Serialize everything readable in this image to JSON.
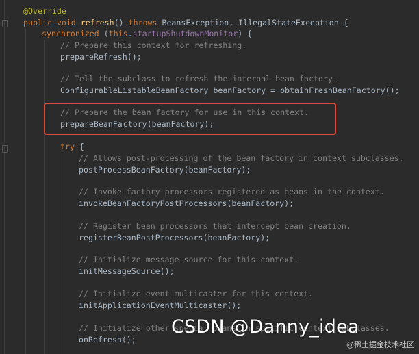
{
  "editor": {
    "lines": [
      [
        {
          "c": "ann",
          "t": "@Override"
        }
      ],
      [
        {
          "c": "kw",
          "t": "public void "
        },
        {
          "c": "fn",
          "t": "refresh"
        },
        {
          "c": "plain",
          "t": "() "
        },
        {
          "c": "kw",
          "t": "throws "
        },
        {
          "c": "plain",
          "t": "BeansException, IllegalStateException {"
        }
      ],
      [
        {
          "c": "kw",
          "t": "synchronized "
        },
        {
          "c": "plain",
          "t": "("
        },
        {
          "c": "kw",
          "t": "this"
        },
        {
          "c": "plain",
          "t": "."
        },
        {
          "c": "fld",
          "t": "startupShutdownMonitor"
        },
        {
          "c": "plain",
          "t": ") {"
        }
      ],
      [
        {
          "c": "cm",
          "t": "// Prepare this context for refreshing."
        }
      ],
      [
        {
          "c": "plain",
          "t": "prepareRefresh();"
        }
      ],
      [
        {
          "c": "cm",
          "t": "// Tell the subclass to refresh the internal bean factory."
        }
      ],
      [
        {
          "c": "plain",
          "t": "ConfigurableListableBeanFactory beanFactory = obtainFreshBeanFactory();"
        }
      ],
      [
        {
          "c": "cm",
          "t": "// Prepare the bean factory for use in this context."
        }
      ],
      [
        {
          "c": "plain",
          "t": "prepareBeanFa"
        },
        {
          "c": "caret",
          "t": ""
        },
        {
          "c": "plain",
          "t": "ctory(beanFactory);"
        }
      ],
      [
        {
          "c": "kw",
          "t": "try "
        },
        {
          "c": "plain",
          "t": "{"
        }
      ],
      [
        {
          "c": "cm",
          "t": "// Allows post-processing of the bean factory in context subclasses."
        }
      ],
      [
        {
          "c": "plain",
          "t": "postProcessBeanFactory(beanFactory);"
        }
      ],
      [
        {
          "c": "cm",
          "t": "// Invoke factory processors registered as beans in the context."
        }
      ],
      [
        {
          "c": "plain",
          "t": "invokeBeanFactoryPostProcessors(beanFactory);"
        }
      ],
      [
        {
          "c": "cm",
          "t": "// Register bean processors that intercept bean creation."
        }
      ],
      [
        {
          "c": "plain",
          "t": "registerBeanPostProcessors(beanFactory);"
        }
      ],
      [
        {
          "c": "cm",
          "t": "// Initialize message source for this context."
        }
      ],
      [
        {
          "c": "plain",
          "t": "initMessageSource();"
        }
      ],
      [
        {
          "c": "cm",
          "t": "// Initialize event multicaster for this context."
        }
      ],
      [
        {
          "c": "plain",
          "t": "initApplicationEventMulticaster();"
        }
      ],
      [
        {
          "c": "cm",
          "t": "// Initialize other special beans in specific context subclasses."
        }
      ],
      [
        {
          "c": "plain",
          "t": "onRefresh();"
        }
      ]
    ]
  },
  "watermark": {
    "main": "CSDN @Danny_idea",
    "sub": "@稀土掘金技术社区"
  },
  "colors": {
    "background": "#2b2b2b",
    "highlight_border": "#d94b3b"
  }
}
